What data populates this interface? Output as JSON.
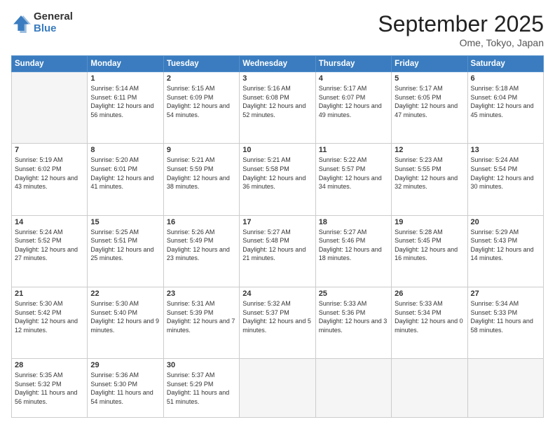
{
  "logo": {
    "general": "General",
    "blue": "Blue"
  },
  "header": {
    "month": "September 2025",
    "location": "Ome, Tokyo, Japan"
  },
  "weekdays": [
    "Sunday",
    "Monday",
    "Tuesday",
    "Wednesday",
    "Thursday",
    "Friday",
    "Saturday"
  ],
  "weeks": [
    [
      {
        "day": "",
        "empty": true
      },
      {
        "day": "1",
        "sunrise": "5:14 AM",
        "sunset": "6:11 PM",
        "daylight": "12 hours and 56 minutes."
      },
      {
        "day": "2",
        "sunrise": "5:15 AM",
        "sunset": "6:09 PM",
        "daylight": "12 hours and 54 minutes."
      },
      {
        "day": "3",
        "sunrise": "5:16 AM",
        "sunset": "6:08 PM",
        "daylight": "12 hours and 52 minutes."
      },
      {
        "day": "4",
        "sunrise": "5:17 AM",
        "sunset": "6:07 PM",
        "daylight": "12 hours and 49 minutes."
      },
      {
        "day": "5",
        "sunrise": "5:17 AM",
        "sunset": "6:05 PM",
        "daylight": "12 hours and 47 minutes."
      },
      {
        "day": "6",
        "sunrise": "5:18 AM",
        "sunset": "6:04 PM",
        "daylight": "12 hours and 45 minutes."
      }
    ],
    [
      {
        "day": "7",
        "sunrise": "5:19 AM",
        "sunset": "6:02 PM",
        "daylight": "12 hours and 43 minutes."
      },
      {
        "day": "8",
        "sunrise": "5:20 AM",
        "sunset": "6:01 PM",
        "daylight": "12 hours and 41 minutes."
      },
      {
        "day": "9",
        "sunrise": "5:21 AM",
        "sunset": "5:59 PM",
        "daylight": "12 hours and 38 minutes."
      },
      {
        "day": "10",
        "sunrise": "5:21 AM",
        "sunset": "5:58 PM",
        "daylight": "12 hours and 36 minutes."
      },
      {
        "day": "11",
        "sunrise": "5:22 AM",
        "sunset": "5:57 PM",
        "daylight": "12 hours and 34 minutes."
      },
      {
        "day": "12",
        "sunrise": "5:23 AM",
        "sunset": "5:55 PM",
        "daylight": "12 hours and 32 minutes."
      },
      {
        "day": "13",
        "sunrise": "5:24 AM",
        "sunset": "5:54 PM",
        "daylight": "12 hours and 30 minutes."
      }
    ],
    [
      {
        "day": "14",
        "sunrise": "5:24 AM",
        "sunset": "5:52 PM",
        "daylight": "12 hours and 27 minutes."
      },
      {
        "day": "15",
        "sunrise": "5:25 AM",
        "sunset": "5:51 PM",
        "daylight": "12 hours and 25 minutes."
      },
      {
        "day": "16",
        "sunrise": "5:26 AM",
        "sunset": "5:49 PM",
        "daylight": "12 hours and 23 minutes."
      },
      {
        "day": "17",
        "sunrise": "5:27 AM",
        "sunset": "5:48 PM",
        "daylight": "12 hours and 21 minutes."
      },
      {
        "day": "18",
        "sunrise": "5:27 AM",
        "sunset": "5:46 PM",
        "daylight": "12 hours and 18 minutes."
      },
      {
        "day": "19",
        "sunrise": "5:28 AM",
        "sunset": "5:45 PM",
        "daylight": "12 hours and 16 minutes."
      },
      {
        "day": "20",
        "sunrise": "5:29 AM",
        "sunset": "5:43 PM",
        "daylight": "12 hours and 14 minutes."
      }
    ],
    [
      {
        "day": "21",
        "sunrise": "5:30 AM",
        "sunset": "5:42 PM",
        "daylight": "12 hours and 12 minutes."
      },
      {
        "day": "22",
        "sunrise": "5:30 AM",
        "sunset": "5:40 PM",
        "daylight": "12 hours and 9 minutes."
      },
      {
        "day": "23",
        "sunrise": "5:31 AM",
        "sunset": "5:39 PM",
        "daylight": "12 hours and 7 minutes."
      },
      {
        "day": "24",
        "sunrise": "5:32 AM",
        "sunset": "5:37 PM",
        "daylight": "12 hours and 5 minutes."
      },
      {
        "day": "25",
        "sunrise": "5:33 AM",
        "sunset": "5:36 PM",
        "daylight": "12 hours and 3 minutes."
      },
      {
        "day": "26",
        "sunrise": "5:33 AM",
        "sunset": "5:34 PM",
        "daylight": "12 hours and 0 minutes."
      },
      {
        "day": "27",
        "sunrise": "5:34 AM",
        "sunset": "5:33 PM",
        "daylight": "11 hours and 58 minutes."
      }
    ],
    [
      {
        "day": "28",
        "sunrise": "5:35 AM",
        "sunset": "5:32 PM",
        "daylight": "11 hours and 56 minutes."
      },
      {
        "day": "29",
        "sunrise": "5:36 AM",
        "sunset": "5:30 PM",
        "daylight": "11 hours and 54 minutes."
      },
      {
        "day": "30",
        "sunrise": "5:37 AM",
        "sunset": "5:29 PM",
        "daylight": "11 hours and 51 minutes."
      },
      {
        "day": "",
        "empty": true
      },
      {
        "day": "",
        "empty": true
      },
      {
        "day": "",
        "empty": true
      },
      {
        "day": "",
        "empty": true
      }
    ]
  ]
}
